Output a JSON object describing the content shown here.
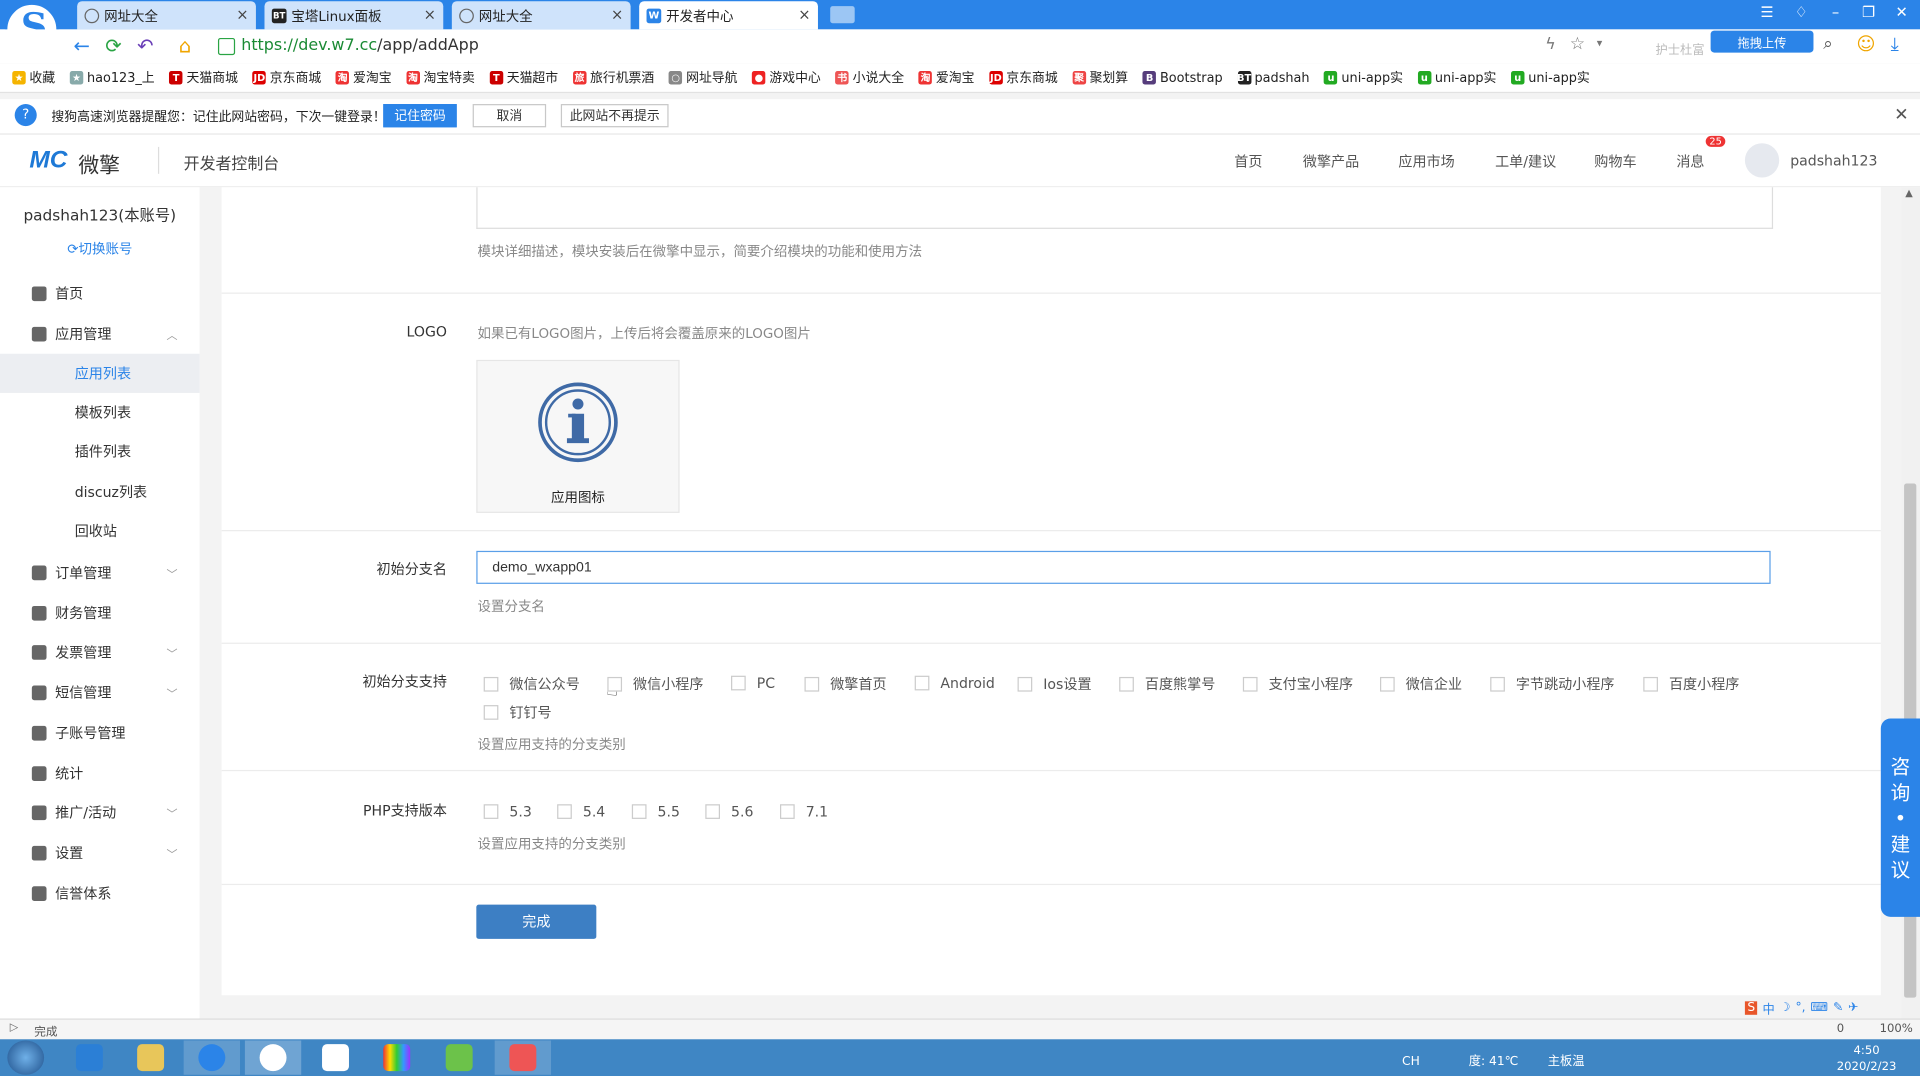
{
  "browser": {
    "tabs": [
      {
        "label": "网址大全",
        "icon": "globe-icon",
        "active": false
      },
      {
        "label": "宝塔Linux面板",
        "icon": "bt-icon",
        "active": false
      },
      {
        "label": "网址大全",
        "icon": "globe-icon",
        "active": false
      },
      {
        "label": "开发者中心",
        "icon": "w7-icon",
        "active": true
      }
    ],
    "url_scheme_host": "https://dev.w7.cc",
    "url_path": "/app/addApp",
    "search_hint": "护士杜富",
    "upload_label": "拖拽上传",
    "bookmarks": [
      {
        "label": "收藏",
        "color": "#f5b400"
      },
      {
        "label": "hao123_上",
        "color": "#8aa"
      },
      {
        "label": "天猫商城",
        "color": "#c00",
        "glyph": "T"
      },
      {
        "label": "京东商城",
        "color": "#d00",
        "glyph": "JD"
      },
      {
        "label": "爱淘宝",
        "color": "#e33",
        "glyph": "淘"
      },
      {
        "label": "淘宝特卖",
        "color": "#e33",
        "glyph": "淘"
      },
      {
        "label": "天猫超市",
        "color": "#c00",
        "glyph": "T"
      },
      {
        "label": "旅行机票酒",
        "color": "#e33",
        "glyph": "旅"
      },
      {
        "label": "网址导航",
        "color": "#888",
        "glyph": "○"
      },
      {
        "label": "游戏中心",
        "color": "#e22",
        "glyph": "●"
      },
      {
        "label": "小说大全",
        "color": "#e55",
        "glyph": "书"
      },
      {
        "label": "爱淘宝",
        "color": "#e33",
        "glyph": "淘"
      },
      {
        "label": "京东商城",
        "color": "#d00",
        "glyph": "JD"
      },
      {
        "label": "聚划算",
        "color": "#e44",
        "glyph": "聚"
      },
      {
        "label": "Bootstrap",
        "color": "#563d7c",
        "glyph": "B"
      },
      {
        "label": "padshah",
        "color": "#222",
        "glyph": "BT"
      },
      {
        "label": "uni-app实",
        "color": "#2a2",
        "glyph": "u"
      },
      {
        "label": "uni-app实",
        "color": "#2a2",
        "glyph": "u"
      },
      {
        "label": "uni-app实",
        "color": "#2a2",
        "glyph": "u"
      }
    ],
    "notice": {
      "text": "搜狗高速浏览器提醒您：记住此网站密码，下次一键登录！",
      "remember": "记住密码",
      "cancel": "取消",
      "never": "此网站不再提示"
    }
  },
  "header": {
    "brand": "MC",
    "brand_name": "微擎",
    "console": "开发者控制台",
    "nav": [
      "首页",
      "微擎产品",
      "应用市场",
      "工单/建议",
      "购物车",
      "消息"
    ],
    "message_count": "25",
    "username": "padshah123"
  },
  "sidebar": {
    "account": "padshah123(本账号)",
    "switch": "切换账号",
    "items": [
      {
        "label": "首页",
        "icon": "home-icon",
        "level": 1
      },
      {
        "label": "应用管理",
        "icon": "cube-icon",
        "level": 1,
        "expanded": true
      },
      {
        "label": "应用列表",
        "level": 2,
        "selected": true
      },
      {
        "label": "模板列表",
        "level": 2
      },
      {
        "label": "插件列表",
        "level": 2
      },
      {
        "label": "discuz列表",
        "level": 2
      },
      {
        "label": "回收站",
        "level": 2
      },
      {
        "label": "订单管理",
        "icon": "order-icon",
        "level": 1,
        "arrow": true
      },
      {
        "label": "财务管理",
        "icon": "wallet-icon",
        "level": 1
      },
      {
        "label": "发票管理",
        "icon": "invoice-icon",
        "level": 1,
        "arrow": true
      },
      {
        "label": "短信管理",
        "icon": "mail-icon",
        "level": 1,
        "arrow": true
      },
      {
        "label": "子账号管理",
        "icon": "user-icon",
        "level": 1
      },
      {
        "label": "统计",
        "icon": "chart-icon",
        "level": 1
      },
      {
        "label": "推广/活动",
        "icon": "megaphone-icon",
        "level": 1,
        "arrow": true
      },
      {
        "label": "设置",
        "icon": "gear-icon",
        "level": 1,
        "arrow": true
      },
      {
        "label": "信誉体系",
        "icon": "medal-icon",
        "level": 1
      }
    ]
  },
  "form": {
    "desc_help": "模块详细描述，模块安装后在微擎中显示，简要介绍模块的功能和使用方法",
    "logo_label": "LOGO",
    "logo_help": "如果已有LOGO图片，上传后将会覆盖原来的LOGO图片",
    "logo_caption": "应用图标",
    "branch_label": "初始分支名",
    "branch_value": "demo_wxapp01",
    "branch_help": "设置分支名",
    "support_label": "初始分支支持",
    "support_options": [
      "微信公众号",
      "微信小程序",
      "PC",
      "微擎首页",
      "Android",
      "Ios设置",
      "百度熊掌号",
      "支付宝小程序",
      "微信企业",
      "字节跳动小程序",
      "百度小程序",
      "钉钉号"
    ],
    "support_help": "设置应用支持的分支类别",
    "php_label": "PHP支持版本",
    "php_options": [
      "5.3",
      "5.4",
      "5.5",
      "5.6",
      "7.1"
    ],
    "php_help": "设置应用支持的分支类别",
    "submit": "完成"
  },
  "consult": [
    "咨",
    "询",
    "•",
    "建",
    "议"
  ],
  "status": {
    "text": "完成",
    "zoom": "100%",
    "count": "0"
  },
  "taskbar": {
    "cpu_temp": "度: 41℃",
    "board": "主板温",
    "time": "4:50",
    "date": "2020/2/23",
    "lang": "CH"
  },
  "colors": {
    "accent": "#2b84e8",
    "tabbar": "#2b84e8",
    "taskbar": "#3f86c4"
  }
}
